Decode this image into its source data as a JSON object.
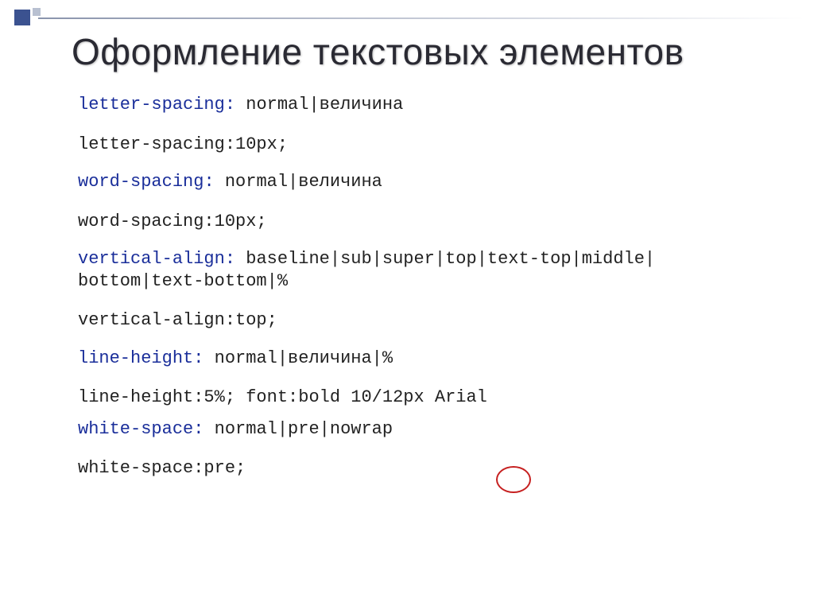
{
  "title": "Оформление текстовых элементов",
  "lines": {
    "l1_prop": "letter-spacing",
    "l1_colon": ": ",
    "l1_val": "normal|величина",
    "l2": "letter-spacing:10px;",
    "l3_prop": "word-spacing",
    "l3_colon": ": ",
    "l3_val": "normal|величина",
    "l4": "word-spacing:10px;",
    "l5_prop": "vertical-align",
    "l5_colon": ": ",
    "l5_val": "baseline|sub|super|top|text-top|middle| bottom|text-bottom|%",
    "l6": "vertical-align:top;",
    "l7_prop": "line-height",
    "l7_colon": ": ",
    "l7_val": "normal|величина|%",
    "l8": "line-height:5%; font:bold 10/12px Arial",
    "l9_prop": "white-space",
    "l9_colon": ": ",
    "l9_val": "normal|pre|nowrap",
    "l10": "white-space:pre;"
  }
}
